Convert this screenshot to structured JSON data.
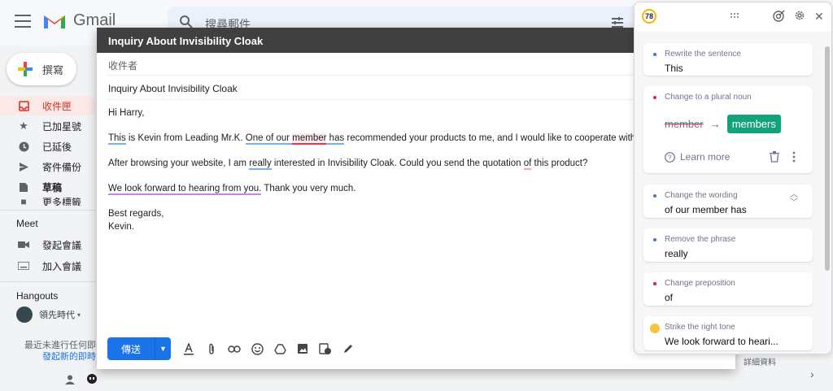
{
  "gmail": {
    "app_name": "Gmail",
    "search_placeholder": "搜尋郵件",
    "compose_label": "撰寫",
    "nav": [
      "收件匣",
      "已加星號",
      "已延後",
      "寄件備份",
      "草稿"
    ],
    "nav_partial": "更多標籤",
    "meet": {
      "title": "Meet",
      "items": [
        "發起會議",
        "加入會議"
      ]
    },
    "hangouts": {
      "title": "Hangouts",
      "user": "領先時代"
    },
    "side_note_line1": "最近未進行任何即",
    "side_note_link": "發起新的即時",
    "right_edge_text": "詳細資料",
    "colors": {
      "active_nav": "#d93025",
      "send": "#1a73e8"
    }
  },
  "compose": {
    "title": "Inquiry About Invisibility Cloak",
    "to_placeholder": "收件者",
    "subject": "Inquiry About Invisibility Cloak",
    "greeting": "Hi Harry,",
    "p1": {
      "w_this": "This",
      "t1": " is Kevin from Leading Mr.K. ",
      "w_our": "One of our ",
      "w_member": "member",
      "w_has": " has",
      "t2": " recommended your products to me, and I would like to cooperate with you."
    },
    "p2": {
      "t1": "After browsing your website, I am ",
      "w_really": "really",
      "t2": " interested in Invisibility Cloak. Could you send the quotation ",
      "w_of": "of",
      "t3": " this product?"
    },
    "p3": {
      "w_tone": "We look forward to hearing from you.",
      "t1": " Thank you very much."
    },
    "closing": "Best regards,",
    "signature": "Kevin.",
    "send_label": "傳送"
  },
  "panel": {
    "score": "78",
    "cards": [
      {
        "title": "Rewrite the sentence",
        "value": "This",
        "dot": "#4a6ee0"
      },
      {
        "title": "Change to a plural noun",
        "original": "member",
        "replacement": "members",
        "learn_more": "Learn more",
        "dot": "#d0253b"
      },
      {
        "title": "Change the wording",
        "value": "of our member has",
        "dot": "#4a6ee0"
      },
      {
        "title": "Remove the phrase",
        "value": "really",
        "dot": "#4a6ee0"
      },
      {
        "title": "Change preposition",
        "value": "of",
        "dot": "#d0253b"
      },
      {
        "title": "Strike the right tone",
        "value": "We look forward to heari..."
      }
    ]
  }
}
